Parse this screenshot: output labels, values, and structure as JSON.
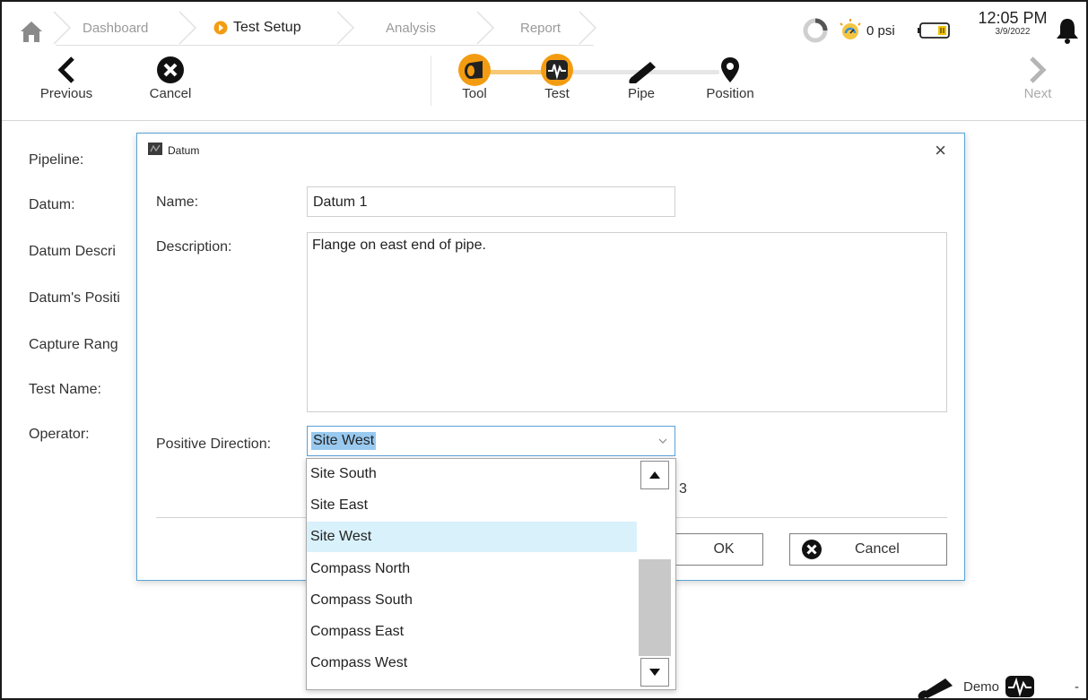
{
  "breadcrumbs": {
    "dashboard": "Dashboard",
    "test_setup": "Test Setup",
    "analysis": "Analysis",
    "report": "Report"
  },
  "status": {
    "pressure": "0 psi",
    "time": "12:05 PM",
    "date": "3/9/2022"
  },
  "toolbar": {
    "previous": "Previous",
    "cancel": "Cancel",
    "next": "Next",
    "steps": {
      "tool": "Tool",
      "test": "Test",
      "pipe": "Pipe",
      "position": "Position"
    }
  },
  "form": {
    "pipeline": "Pipeline:",
    "datum": "Datum:",
    "datum_description": "Datum Descri",
    "datums_position": "Datum's Positi",
    "capture_range": "Capture Rang",
    "test_name": "Test Name:",
    "operator": "Operator:"
  },
  "dialog": {
    "title": "Datum",
    "name_label": "Name:",
    "name_value": "Datum 1",
    "description_label": "Description:",
    "description_value": "Flange on east end of pipe.",
    "direction_label": "Positive Direction:",
    "direction_value": "Site West",
    "hidden_text": "3",
    "ok": "OK",
    "cancel": "Cancel"
  },
  "dropdown": {
    "options": [
      "Site South",
      "Site East",
      "Site West",
      "Compass North",
      "Compass South",
      "Compass East",
      "Compass West"
    ],
    "selected": "Site West"
  },
  "footer": {
    "demo": "Demo",
    "trailing": "-"
  },
  "colors": {
    "accent_orange": "#f39c12",
    "dialog_border": "#57a4d6",
    "selection_bg": "#d9f1fb",
    "highlight_text_bg": "#99c9ef"
  }
}
